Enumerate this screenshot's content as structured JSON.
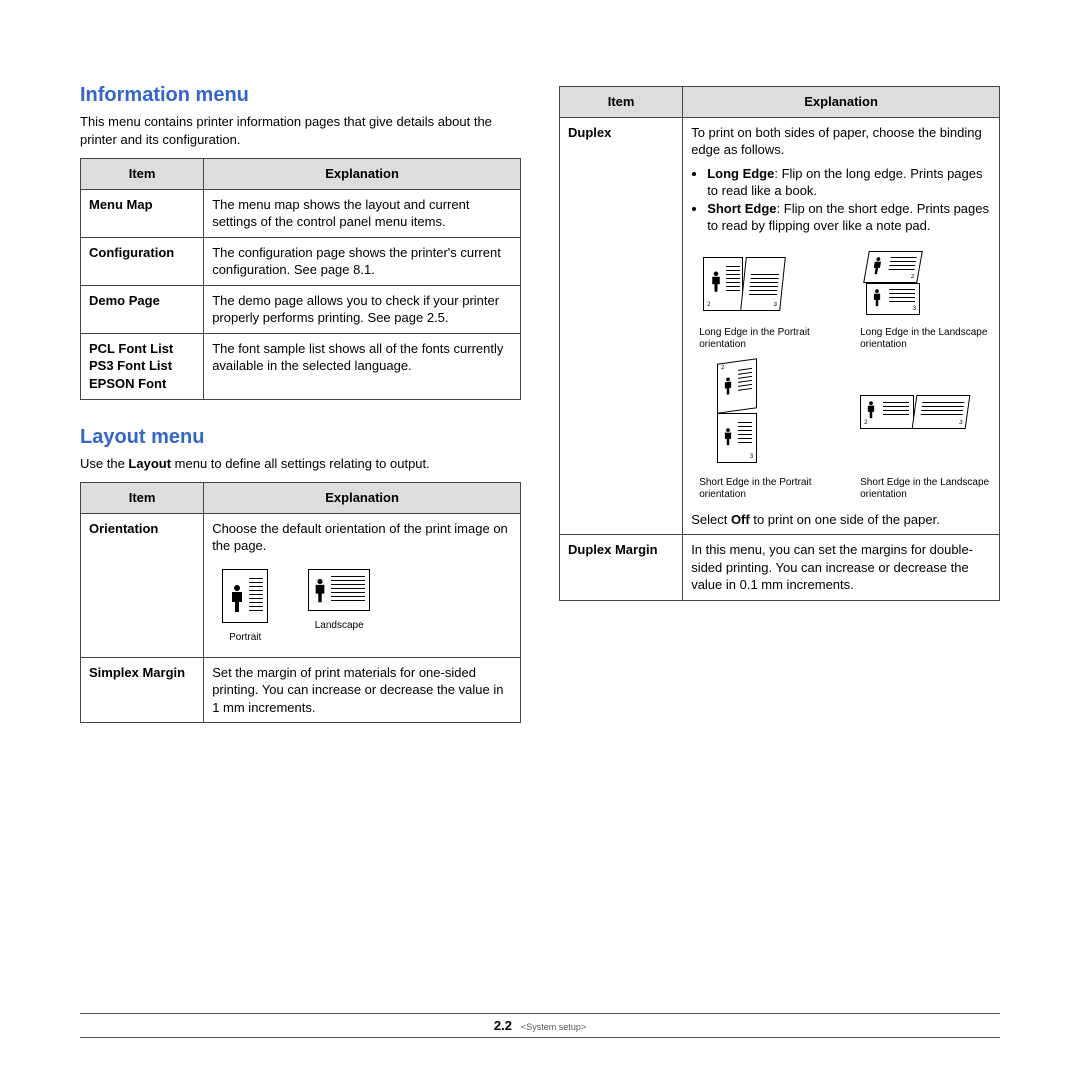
{
  "info": {
    "title": "Information menu",
    "intro": "This menu contains printer information pages that give details about the printer and its configuration.",
    "head_item": "Item",
    "head_expl": "Explanation",
    "rows": [
      {
        "item": "Menu Map",
        "expl": "The menu map shows the layout and current settings of the control panel menu items."
      },
      {
        "item": "Configuration",
        "expl_a": "The configuration page shows the printer's current configuration. See ",
        "expl_b": "page 8.1",
        "expl_c": "."
      },
      {
        "item": "Demo Page",
        "expl_a": "The demo page allows you to check if your printer properly performs printing. See ",
        "expl_b": "page 2.5",
        "expl_c": "."
      },
      {
        "item_a": "PCL Font List",
        "item_b": "PS3 Font List",
        "item_c": "EPSON Font",
        "expl": "The font sample list shows all of the fonts currently available in the selected language."
      }
    ]
  },
  "layout": {
    "title": "Layout menu",
    "intro_a": "Use the ",
    "intro_b": "Layout",
    "intro_c": " menu to define all settings relating to output.",
    "head_item": "Item",
    "head_expl": "Explanation",
    "orientation": {
      "item": "Orientation",
      "expl": "Choose the default orientation of the print image on the page.",
      "portrait": "Portrait",
      "landscape": "Landscape"
    },
    "simplex": {
      "item": "Simplex Margin",
      "expl": "Set the margin of print materials for one-sided printing. You can increase or decrease the value in 1 mm increments."
    }
  },
  "right": {
    "head_item": "Item",
    "head_expl": "Explanation",
    "duplex": {
      "item": "Duplex",
      "lead": "To print on both sides of paper, choose the binding edge as follows.",
      "long_label": "Long Edge",
      "long_text": ": Flip on the long edge. Prints pages to read like a book.",
      "short_label": "Short Edge",
      "short_text": ": Flip on the short edge. Prints pages to read by flipping over like a note pad.",
      "cap1": "Long Edge in the Portrait orientation",
      "cap2": "Long Edge in the Landscape orientation",
      "cap3": "Short Edge in the Portrait orientation",
      "cap4": "Short Edge in the Landscape orientation",
      "off_a": "Select ",
      "off_b": "Off",
      "off_c": " to print on one side of the paper."
    },
    "dmargin": {
      "item": "Duplex Margin",
      "expl": "In this menu, you can set the margins for double-sided printing. You can increase or decrease the value in 0.1 mm increments."
    }
  },
  "footer": {
    "page_chapter": "2",
    "page_sub": ".2",
    "section": "<System setup>"
  }
}
